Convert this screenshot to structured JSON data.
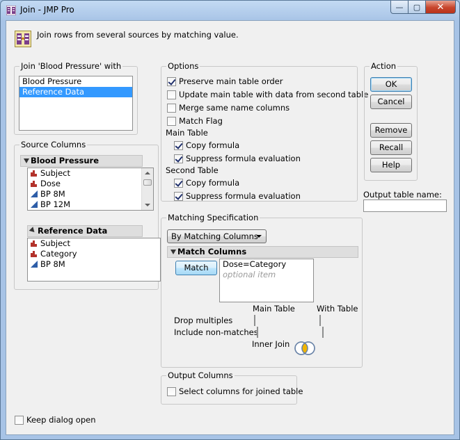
{
  "window": {
    "title": "Join - JMP Pro",
    "minimize_glyph": "—",
    "maximize_glyph": "▢",
    "close_glyph": "✕"
  },
  "header": {
    "description": "Join rows from several sources by matching value.",
    "icon": "join-icon"
  },
  "join_with": {
    "legend": "Join 'Blood Pressure' with",
    "tables": [
      {
        "label": "Blood Pressure",
        "selected": false
      },
      {
        "label": "Reference Data",
        "selected": true
      }
    ]
  },
  "source_columns": {
    "legend": "Source Columns",
    "tables": [
      {
        "name": "Blood Pressure",
        "columns": [
          {
            "label": "Subject",
            "type": "nominal"
          },
          {
            "label": "Dose",
            "type": "nominal"
          },
          {
            "label": "BP 8M",
            "type": "continuous"
          },
          {
            "label": "BP 12M",
            "type": "continuous"
          }
        ]
      },
      {
        "name": "Reference Data",
        "columns": [
          {
            "label": "Subject",
            "type": "nominal"
          },
          {
            "label": "Category",
            "type": "nominal"
          },
          {
            "label": "BP 8M",
            "type": "continuous"
          }
        ]
      }
    ]
  },
  "options": {
    "legend": "Options",
    "preserve_main_order": {
      "label": "Preserve main table order",
      "checked": true
    },
    "update_main": {
      "label": "Update main table with data from second table",
      "checked": false
    },
    "merge_same_name": {
      "label": "Merge same name columns",
      "checked": false
    },
    "match_flag": {
      "label": "Match Flag",
      "checked": false
    },
    "main_table_label": "Main Table",
    "main_copy_formula": {
      "label": "Copy formula",
      "checked": true
    },
    "main_suppress_eval": {
      "label": "Suppress formula evaluation",
      "checked": true
    },
    "second_table_label": "Second Table",
    "second_copy_formula": {
      "label": "Copy formula",
      "checked": true
    },
    "second_suppress_eval": {
      "label": "Suppress formula evaluation",
      "checked": true
    }
  },
  "action": {
    "legend": "Action",
    "ok": "OK",
    "cancel": "Cancel",
    "remove": "Remove",
    "recall": "Recall",
    "help": "Help",
    "output_name_label": "Output table name:",
    "output_name_value": ""
  },
  "matching": {
    "legend": "Matching Specification",
    "method": "By Matching Columns",
    "match_columns_header": "Match Columns",
    "match_button": "Match",
    "match_items": [
      "Dose=Category"
    ],
    "match_placeholder": "optional item",
    "main_table_header": "Main Table",
    "with_table_header": "With Table",
    "drop_multiples_label": "Drop multiples",
    "include_nonmatches_label": "Include non-matches",
    "drop_multiples_main": false,
    "drop_multiples_with": false,
    "include_nonmatches_main": false,
    "include_nonmatches_with": false,
    "join_type": "Inner Join"
  },
  "output_columns": {
    "legend": "Output Columns",
    "select_columns": {
      "label": "Select columns for joined table",
      "checked": false
    }
  },
  "keep_dialog_open": {
    "label": "Keep dialog open",
    "checked": false
  },
  "colors": {
    "selection": "#3399ff",
    "nominal_icon": "#b3322b",
    "continuous_icon": "#2e5ea8",
    "venn_fill": "#f0b400"
  }
}
